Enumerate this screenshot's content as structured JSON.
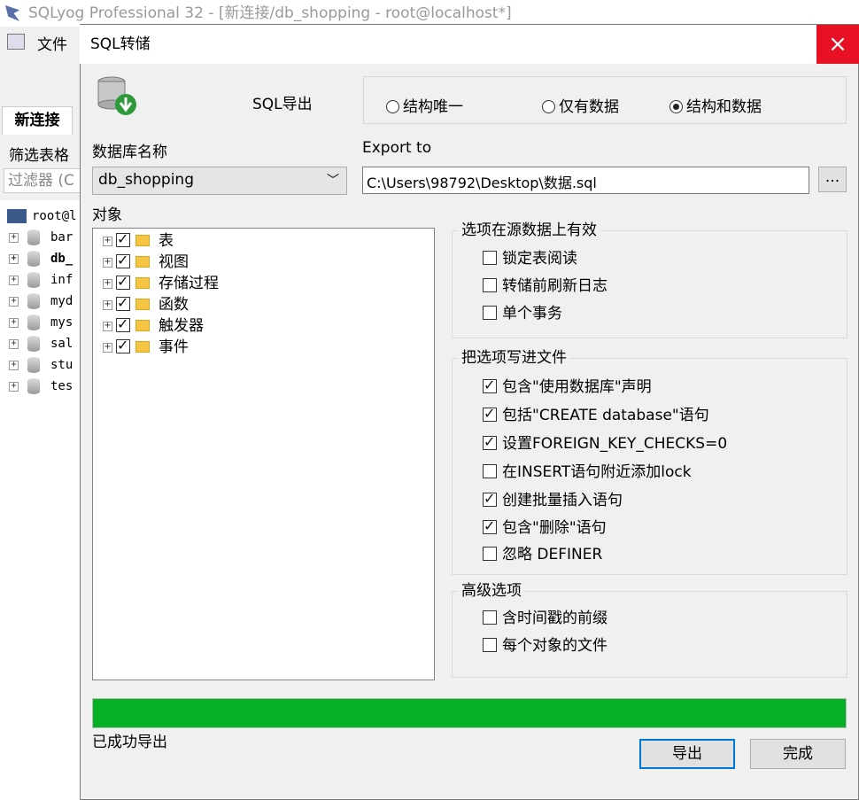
{
  "main_window": {
    "title": "SQLyog Professional 32 - [新连接/db_shopping - root@localhost*]",
    "menu_file": "文件",
    "tab_label": "新连接",
    "filter_label": "筛选表格",
    "filter_placeholder": "过滤器 (C",
    "tree": [
      "root@l",
      "bar",
      "db_",
      "inf",
      "myd",
      "mys",
      "sal",
      "stu",
      "tes"
    ]
  },
  "dialog": {
    "title": "SQL转储",
    "close_icon": "×",
    "export_label": "SQL导出",
    "export_mode": {
      "options": [
        "结构唯一",
        "仅有数据",
        "结构和数据"
      ],
      "selected": 2
    },
    "db_label": "数据库名称",
    "db_value": "db_shopping",
    "export_to_label": "Export to",
    "export_path": "C:\\Users\\98792\\Desktop\\数据.sql",
    "browse_label": "...",
    "objects_label": "对象",
    "objects": [
      {
        "label": "表",
        "checked": true
      },
      {
        "label": "视图",
        "checked": true
      },
      {
        "label": "存储过程",
        "checked": true
      },
      {
        "label": "函数",
        "checked": true
      },
      {
        "label": "触发器",
        "checked": true
      },
      {
        "label": "事件",
        "checked": true
      }
    ],
    "source_group": {
      "title": "选项在源数据上有效",
      "options": [
        {
          "label": "锁定表阅读",
          "checked": false
        },
        {
          "label": "转储前刷新日志",
          "checked": false
        },
        {
          "label": "单个事务",
          "checked": false
        }
      ]
    },
    "write_group": {
      "title": "把选项写进文件",
      "options": [
        {
          "label": "包含\"使用数据库\"声明",
          "checked": true
        },
        {
          "label": "包括\"CREATE database\"语句",
          "checked": true
        },
        {
          "label": "设置FOREIGN_KEY_CHECKS=0",
          "checked": true
        },
        {
          "label": "在INSERT语句附近添加lock",
          "checked": false
        },
        {
          "label": "创建批量插入语句",
          "checked": true
        },
        {
          "label": "包含\"删除\"语句",
          "checked": true
        },
        {
          "label": "忽略 DEFINER",
          "checked": false
        }
      ]
    },
    "advanced_group": {
      "title": "高级选项",
      "options": [
        {
          "label": "含时间戳的前缀",
          "checked": false
        },
        {
          "label": "每个对象的文件",
          "checked": false
        }
      ]
    },
    "progress": {
      "value": 1.0,
      "color": "#06b025"
    },
    "status_text": "已成功导出",
    "export_button": "导出",
    "done_button": "完成",
    "colors": {
      "close_red": "#e81123",
      "accent_blue": "#0078d7"
    }
  }
}
